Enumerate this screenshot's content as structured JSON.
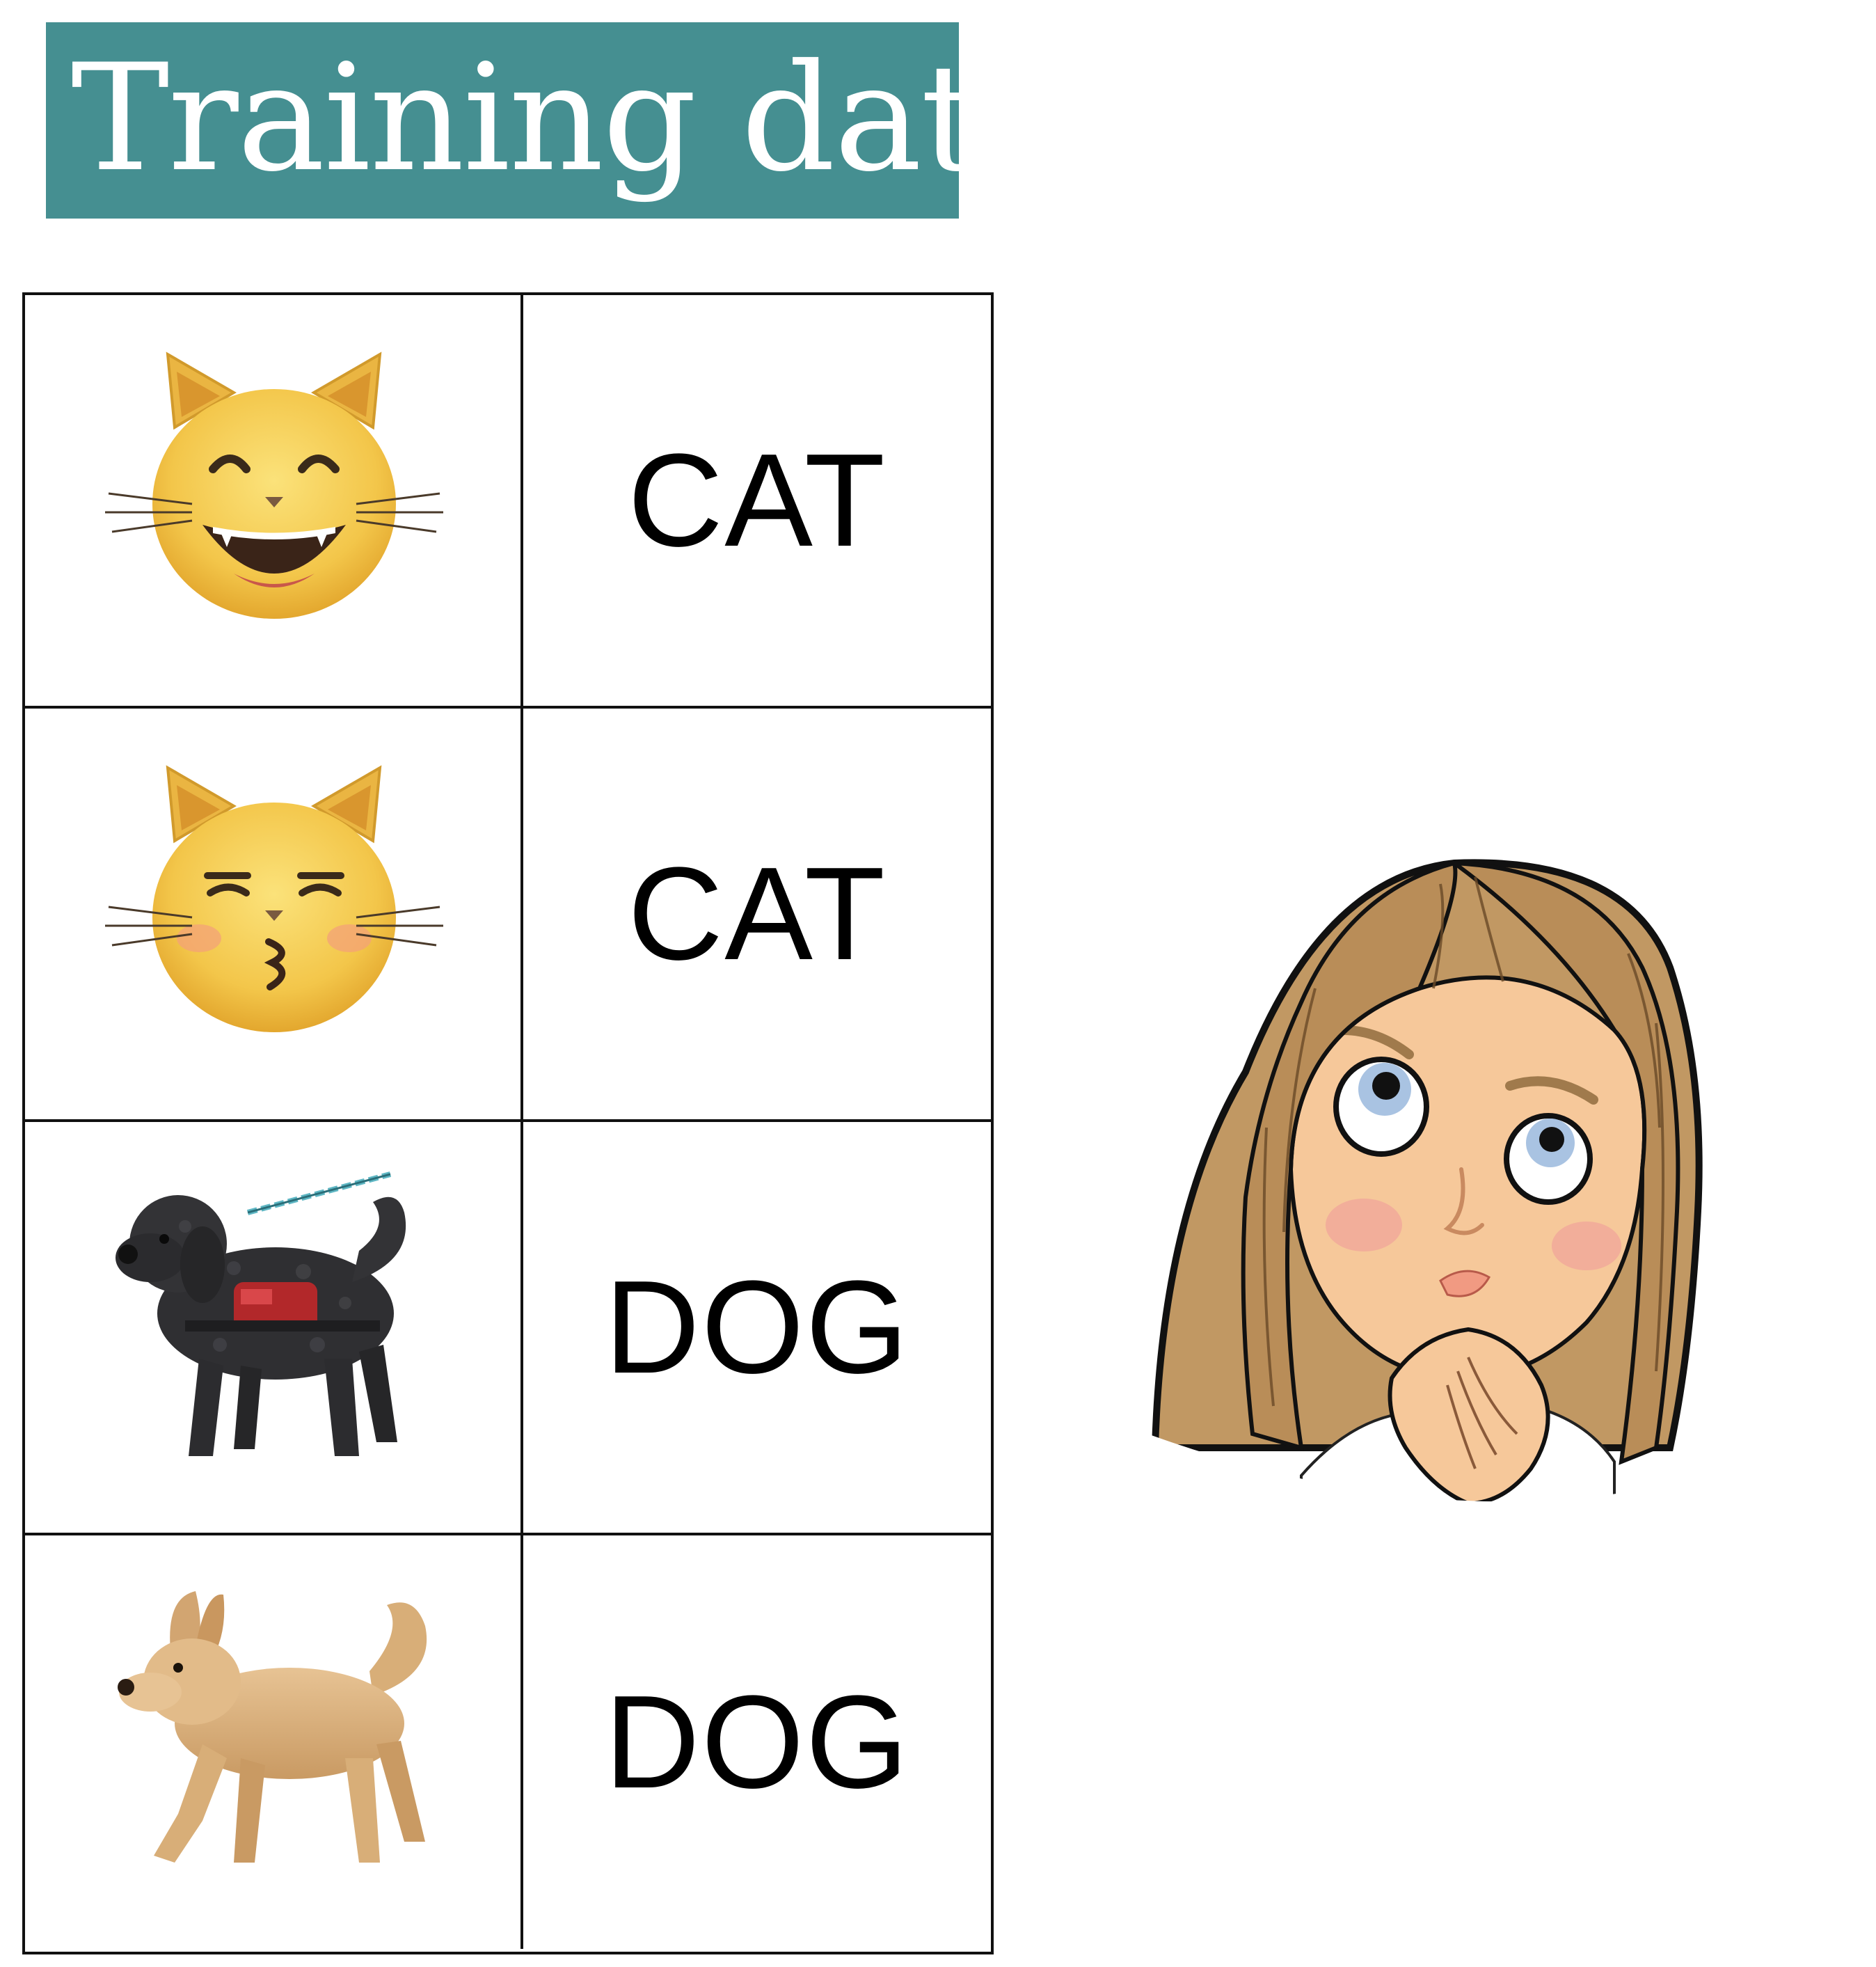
{
  "title": "Training data",
  "table": {
    "rows": [
      {
        "image": "grinning-cat-icon",
        "label": "CAT"
      },
      {
        "image": "kissing-cat-icon",
        "label": "CAT"
      },
      {
        "image": "service-dog-icon",
        "label": "DOG"
      },
      {
        "image": "dog-icon",
        "label": "DOG"
      }
    ]
  },
  "character": "thinking-girl-avatar",
  "colors": {
    "banner": "#458f91",
    "border": "#111111"
  }
}
